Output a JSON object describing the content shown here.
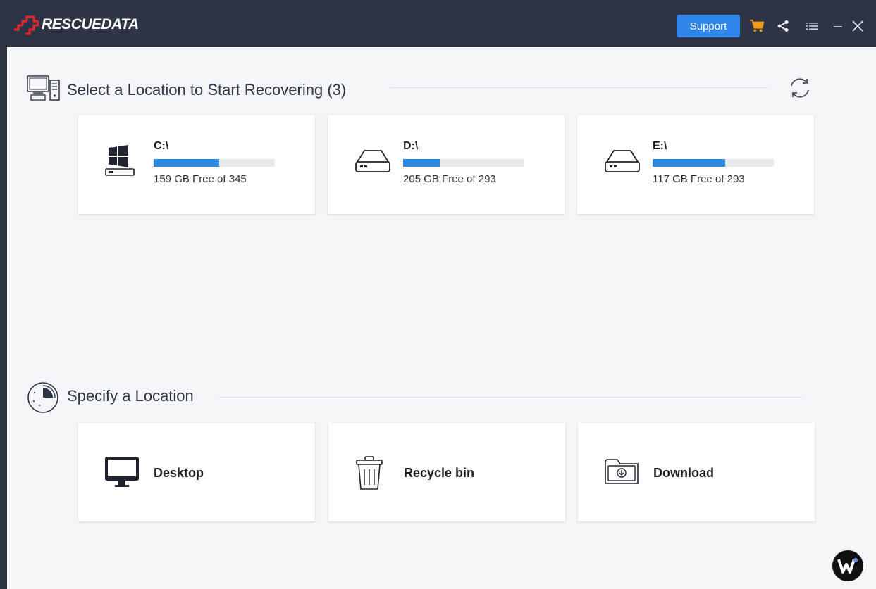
{
  "app": {
    "name": "RESCUEDATA"
  },
  "titlebar": {
    "support_label": "Support",
    "icons": [
      "cart-icon",
      "share-icon",
      "menu-icon",
      "minimize-icon",
      "close-icon"
    ],
    "colors": {
      "bar": "#2d3445",
      "support": "#2f86e8",
      "cart": "#f39c12",
      "logo_red": "#e8262b"
    }
  },
  "drives_section": {
    "title": "Select a Location to Start Recovering (3)",
    "drives": [
      {
        "name": "C:\\",
        "free": "159 GB Free of 345",
        "fill_fraction": 0.54,
        "icon": "windows-drive-icon"
      },
      {
        "name": "D:\\",
        "free": "205 GB Free of 293",
        "fill_fraction": 0.3,
        "icon": "hard-drive-icon"
      },
      {
        "name": "E:\\",
        "free": "117 GB Free of 293",
        "fill_fraction": 0.6,
        "icon": "hard-drive-icon"
      }
    ]
  },
  "locations_section": {
    "title": "Specify a Location",
    "locations": [
      {
        "label": "Desktop",
        "icon": "monitor-icon"
      },
      {
        "label": "Recycle bin",
        "icon": "trash-icon"
      },
      {
        "label": "Download",
        "icon": "download-folder-icon"
      }
    ]
  }
}
